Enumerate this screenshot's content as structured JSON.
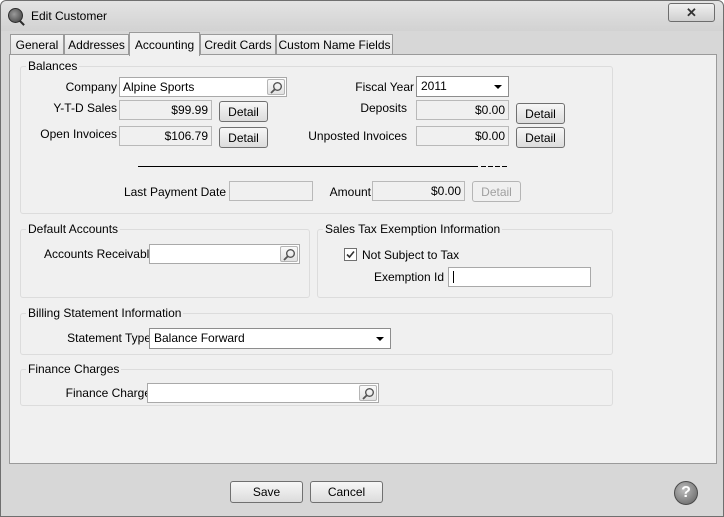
{
  "window": {
    "title": "Edit Customer",
    "close_glyph": "✕"
  },
  "tabs": [
    {
      "label": "General",
      "active": false
    },
    {
      "label": "Addresses",
      "active": false
    },
    {
      "label": "Accounting",
      "active": true
    },
    {
      "label": "Credit Cards",
      "active": false
    },
    {
      "label": "Custom Name Fields",
      "active": false
    }
  ],
  "balances": {
    "title": "Balances",
    "company_label": "Company",
    "company_value": "Alpine Sports",
    "fiscal_year_label": "Fiscal Year",
    "fiscal_year_value": "2011",
    "ytd_sales_label": "Y-T-D Sales",
    "ytd_sales_value": "$99.99",
    "deposits_label": "Deposits",
    "deposits_value": "$0.00",
    "open_invoices_label": "Open Invoices",
    "open_invoices_value": "$106.79",
    "unposted_invoices_label": "Unposted Invoices",
    "unposted_invoices_value": "$0.00",
    "detail_label": "Detail",
    "last_payment_date_label": "Last Payment Date",
    "last_payment_date_value": "",
    "amount_label": "Amount",
    "amount_value": "$0.00"
  },
  "default_accounts": {
    "title": "Default Accounts",
    "ar_label": "Accounts Receivable",
    "ar_value": ""
  },
  "sales_tax": {
    "title": "Sales Tax Exemption Information",
    "not_subject_label": "Not Subject to Tax",
    "not_subject_checked": true,
    "exemption_id_label": "Exemption Id",
    "exemption_id_value": ""
  },
  "billing": {
    "title": "Billing Statement Information",
    "statement_type_label": "Statement Type",
    "statement_type_value": "Balance Forward"
  },
  "finance": {
    "title": "Finance Charges",
    "finance_charge_label": "Finance Charge",
    "finance_charge_value": ""
  },
  "footer": {
    "save_label": "Save",
    "cancel_label": "Cancel",
    "help_glyph": "?"
  },
  "icons": {
    "app": "app-search-icon",
    "lookup": "magnifier-icon",
    "help": "help-icon",
    "close": "close-icon"
  }
}
